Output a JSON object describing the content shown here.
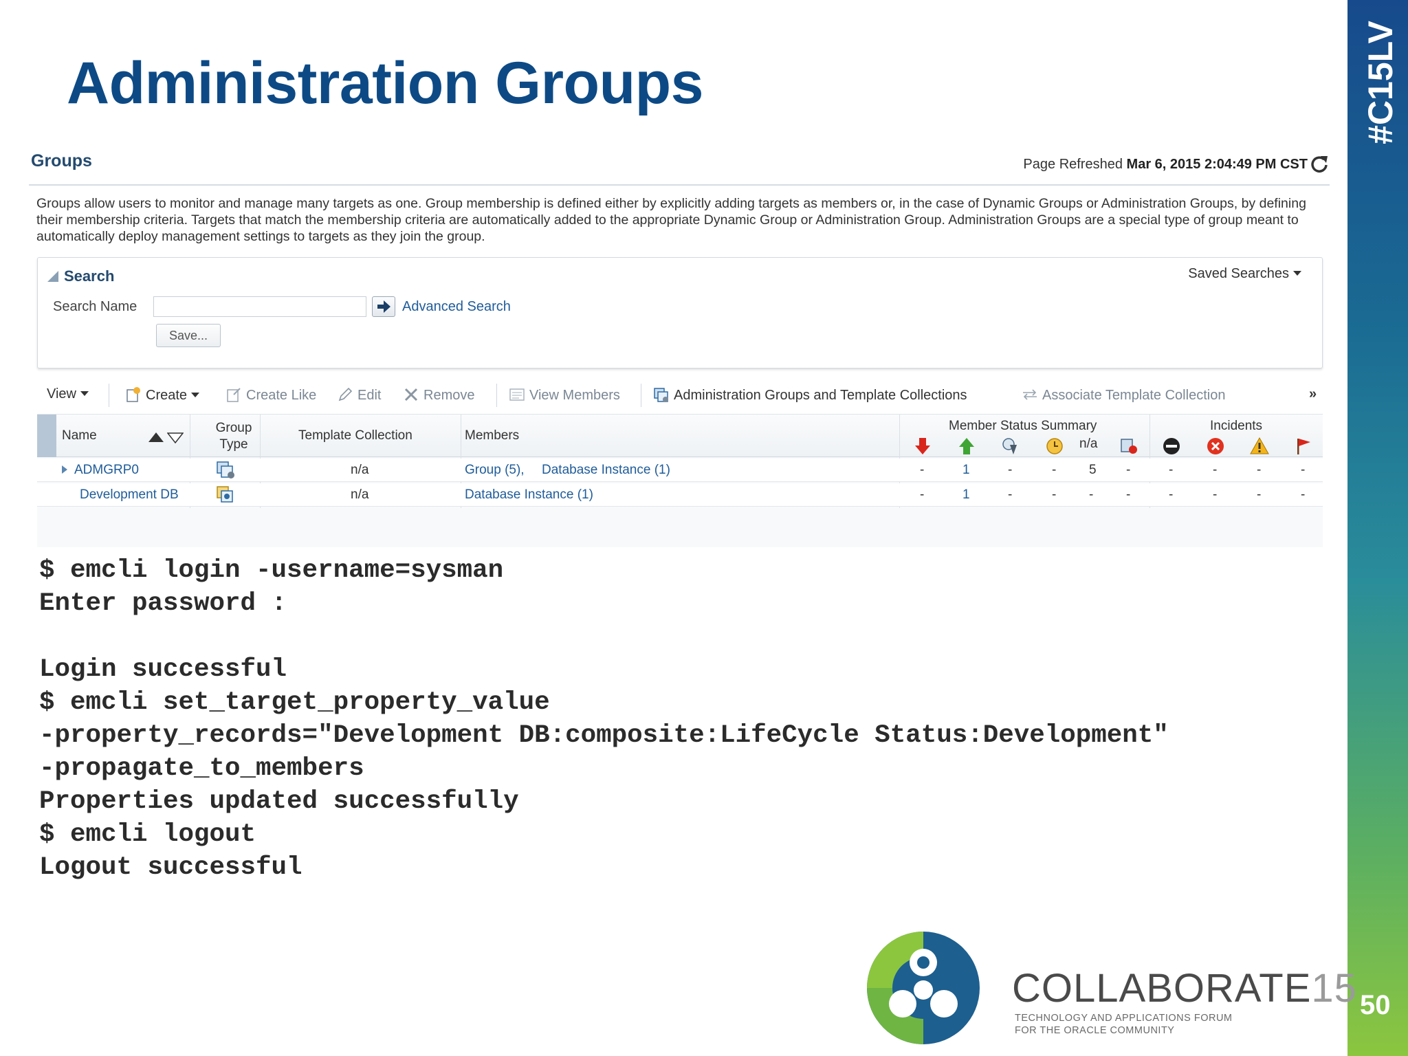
{
  "slide": {
    "title": "Administration Groups",
    "tag": "#C15LV",
    "number": "50"
  },
  "groups_page": {
    "title": "Groups",
    "refresh_label": "Page Refreshed",
    "refresh_time": "Mar 6, 2015 2:04:49 PM CST",
    "description": "Groups allow users to monitor and manage many targets as one. Group membership is defined either by explicitly adding targets as members or, in the case of Dynamic Groups or Administration Groups, by defining their membership criteria. Targets that match the membership criteria are automatically added to the appropriate Dynamic Group or Administration Group. Administration Groups are a special type of group meant to automatically deploy management settings to targets as they join the group."
  },
  "search": {
    "title": "Search",
    "saved_searches": "Saved Searches",
    "name_label": "Search Name",
    "name_value": "",
    "advanced_link": "Advanced Search",
    "save_button": "Save..."
  },
  "toolbar": {
    "view": "View",
    "create": "Create",
    "create_like": "Create Like",
    "edit": "Edit",
    "remove": "Remove",
    "view_members": "View Members",
    "admin_groups": "Administration Groups and Template Collections",
    "associate": "Associate Template Collection",
    "more": "»"
  },
  "table": {
    "headers": {
      "name": "Name",
      "group_type_1": "Group",
      "group_type_2": "Type",
      "template_collection": "Template Collection",
      "members": "Members",
      "member_status_summary": "Member Status Summary",
      "incidents": "Incidents",
      "na": "n/a"
    },
    "rows": [
      {
        "name": "ADMGRP0",
        "template": "n/a",
        "members_a": "Group (5),",
        "members_b": "Database Instance (1)",
        "status": [
          "-",
          "1",
          "-",
          "-",
          "5",
          "-"
        ],
        "incidents": [
          "-",
          "-",
          "-",
          "-"
        ]
      },
      {
        "name": "Development DB",
        "template": "n/a",
        "members_a": "Database Instance (1)",
        "members_b": "",
        "status": [
          "-",
          "1",
          "-",
          "-",
          "-",
          "-"
        ],
        "incidents": [
          "-",
          "-",
          "-",
          "-"
        ]
      }
    ]
  },
  "terminal": {
    "lines": [
      "$ emcli login -username=sysman",
      "Enter password :",
      "",
      "Login successful",
      "$ emcli set_target_property_value",
      "-property_records=\"Development DB:composite:LifeCycle Status:Development\"",
      "-propagate_to_members",
      "Properties updated successfully",
      "$ emcli logout",
      "Logout successful"
    ]
  },
  "logo": {
    "name": "COLLABORATE",
    "year": "15",
    "tagline_1": "TECHNOLOGY AND APPLICATIONS FORUM",
    "tagline_2": "FOR THE ORACLE COMMUNITY"
  },
  "colors": {
    "title": "#0d4a85",
    "link": "#1f5c99",
    "banner_top": "#174a8c",
    "banner_bottom": "#8cc63f"
  }
}
